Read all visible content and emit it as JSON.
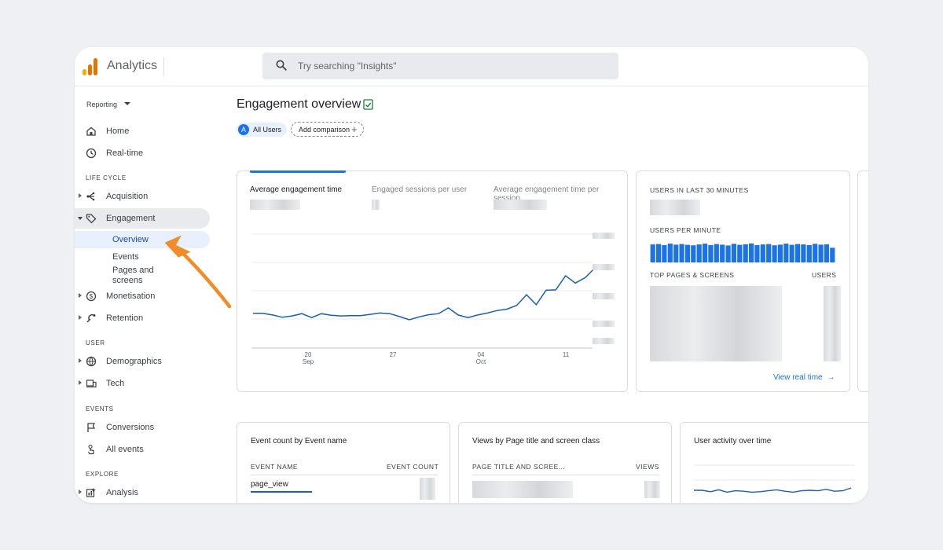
{
  "app": {
    "title": "Analytics"
  },
  "search": {
    "placeholder": "Try searching \"Insights\""
  },
  "sidebar": {
    "reporting_label": "Reporting",
    "home": "Home",
    "realtime": "Real-time",
    "section_lifecycle": "LIFE CYCLE",
    "acquisition": "Acquisition",
    "engagement": "Engagement",
    "engagement_sub": {
      "overview": "Overview",
      "events": "Events",
      "pages_line1": "Pages and",
      "pages_line2": "screens"
    },
    "monetisation": "Monetisation",
    "retention": "Retention",
    "section_user": "USER",
    "demographics": "Demographics",
    "tech": "Tech",
    "section_events": "EVENTS",
    "conversions": "Conversions",
    "all_events": "All events",
    "section_explore": "EXPLORE",
    "analysis": "Analysis"
  },
  "page": {
    "title": "Engagement overview",
    "comparison_chip": {
      "avatar": "A",
      "label": "All Users"
    },
    "add_comparison": "Add comparison"
  },
  "main_chart": {
    "tabs": [
      "Average engagement time",
      "Engaged sessions per user",
      "Average engagement time per session"
    ],
    "active_tab": 0
  },
  "chart_data": {
    "type": "line",
    "title": "",
    "x_tick_labels": [
      {
        "day": "20",
        "month": "Sep"
      },
      {
        "day": "27",
        "month": ""
      },
      {
        "day": "04",
        "month": "Oct"
      },
      {
        "day": "11",
        "month": ""
      }
    ],
    "y_tick_labels": [],
    "series": [
      {
        "values": [
          0.295,
          0.295,
          0.27,
          0.235,
          0.255,
          0.29,
          0.23,
          0.29,
          0.265,
          0.255,
          0.26,
          0.26,
          0.28,
          0.3,
          0.29,
          0.245,
          0.195,
          0.24,
          0.275,
          0.29,
          0.38,
          0.27,
          0.23,
          0.27,
          0.3,
          0.34,
          0.36,
          0.42,
          0.585,
          0.43,
          0.655,
          0.66,
          0.88,
          0.765,
          0.85,
          1.0
        ]
      }
    ],
    "color": "#1a5fb4"
  },
  "realtime": {
    "users_last_30": "USERS IN LAST 30 MINUTES",
    "users_per_minute": "USERS PER MINUTE",
    "per_minute_bars": [
      0.88,
      0.9,
      0.85,
      0.92,
      0.87,
      0.9,
      0.86,
      0.84,
      0.88,
      0.92,
      0.85,
      0.9,
      0.87,
      0.83,
      0.91,
      0.86,
      0.89,
      0.93,
      0.85,
      0.88,
      0.9,
      0.84,
      0.87,
      0.92,
      0.86,
      0.9,
      0.88,
      0.85,
      0.91,
      0.87,
      0.89,
      0.72
    ],
    "top_pages": "TOP PAGES & SCREENS",
    "users_col": "USERS",
    "view_link": "View real time"
  },
  "cards": {
    "event_count": {
      "title": "Event count by Event name",
      "col1": "EVENT NAME",
      "col2": "EVENT COUNT",
      "row1": "page_view"
    },
    "views": {
      "title": "Views by Page title and screen class",
      "col1": "PAGE TITLE AND SCREE...",
      "col2": "VIEWS"
    },
    "activity": {
      "title": "User activity over time",
      "series": [
        0.5,
        0.5,
        0.35,
        0.55,
        0.3,
        0.45,
        0.4,
        0.3,
        0.35,
        0.45,
        0.55,
        0.4,
        0.3,
        0.45,
        0.5,
        0.45,
        0.6,
        0.4,
        0.45,
        0.75
      ]
    }
  },
  "colors": {
    "accent": "#1a73e8",
    "bar": "#1a73e8",
    "arrow": "#f28c28",
    "logo": [
      "#f9ab00",
      "#e37400",
      "#e37400"
    ]
  }
}
